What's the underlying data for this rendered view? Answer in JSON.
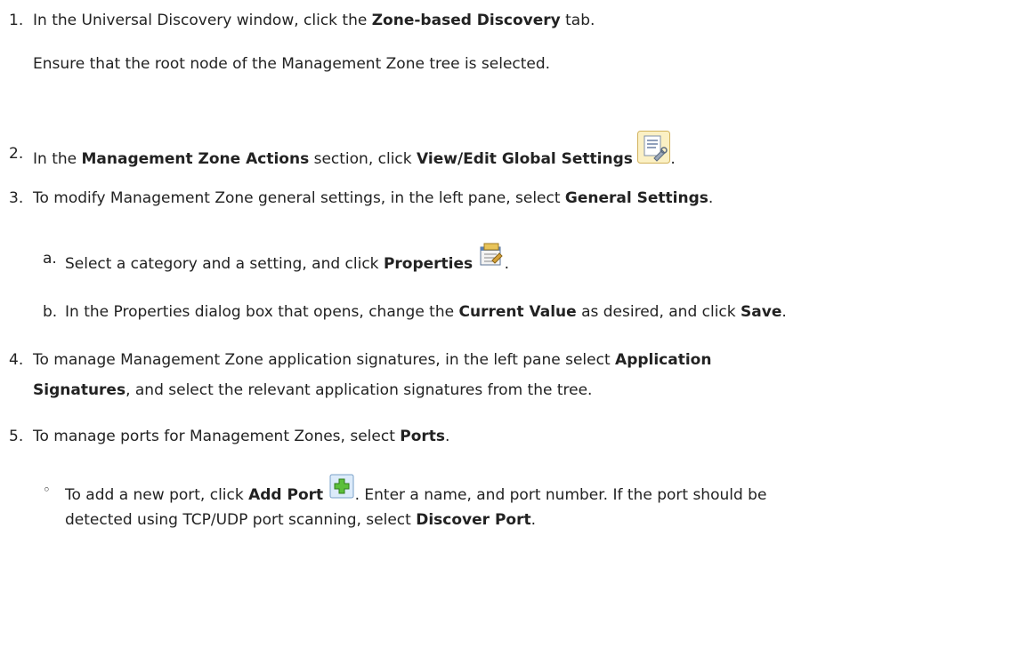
{
  "steps": [
    {
      "number": "1.",
      "text_pre": "In the Universal Discovery window, click the ",
      "bold_1": "Zone-based Discovery",
      "text_post": " tab.",
      "note": "Ensure that the root node of the Management Zone tree is selected."
    },
    {
      "number": "2.",
      "text_pre": "In the ",
      "bold_1": "Management Zone Actions",
      "text_mid": " section, click ",
      "bold_2": "View/Edit Global Settings",
      "icon": "global-settings-icon",
      "text_post": "."
    },
    {
      "number": "3.",
      "text_pre": "To modify Management Zone general settings, in the left pane, select ",
      "bold_1": "General Settings",
      "text_post": ".",
      "substeps": [
        {
          "letter": "a.",
          "text_pre": "Select a category and a setting, and click ",
          "bold_1": "Properties",
          "icon": "properties-icon",
          "text_post": "."
        },
        {
          "letter": "b.",
          "text_pre": "In the Properties dialog box that opens, change the ",
          "bold_1": "Current Value",
          "text_mid": " as desired, and click ",
          "bold_2": "Save",
          "text_post": "."
        }
      ]
    },
    {
      "number": "4.",
      "text_pre": "To manage Management Zone application signatures, in the left pane select ",
      "bold_1": "Application",
      "bold_1b": "Signatures",
      "text_post": ", and select the relevant application signatures from the tree."
    },
    {
      "number": "5.",
      "text_pre": "To manage ports for Management Zones, select ",
      "bold_1": "Ports",
      "text_post": ".",
      "bullets": [
        {
          "marker": "◦",
          "text_pre": "To add a new port, click ",
          "bold_1": "Add Port",
          "icon": "add-port-icon",
          "text_mid": ". Enter a name, and port number. If the port should be",
          "line2_pre": "detected using TCP/UDP port scanning, select ",
          "bold_2": "Discover Port",
          "text_post": "."
        }
      ]
    }
  ]
}
